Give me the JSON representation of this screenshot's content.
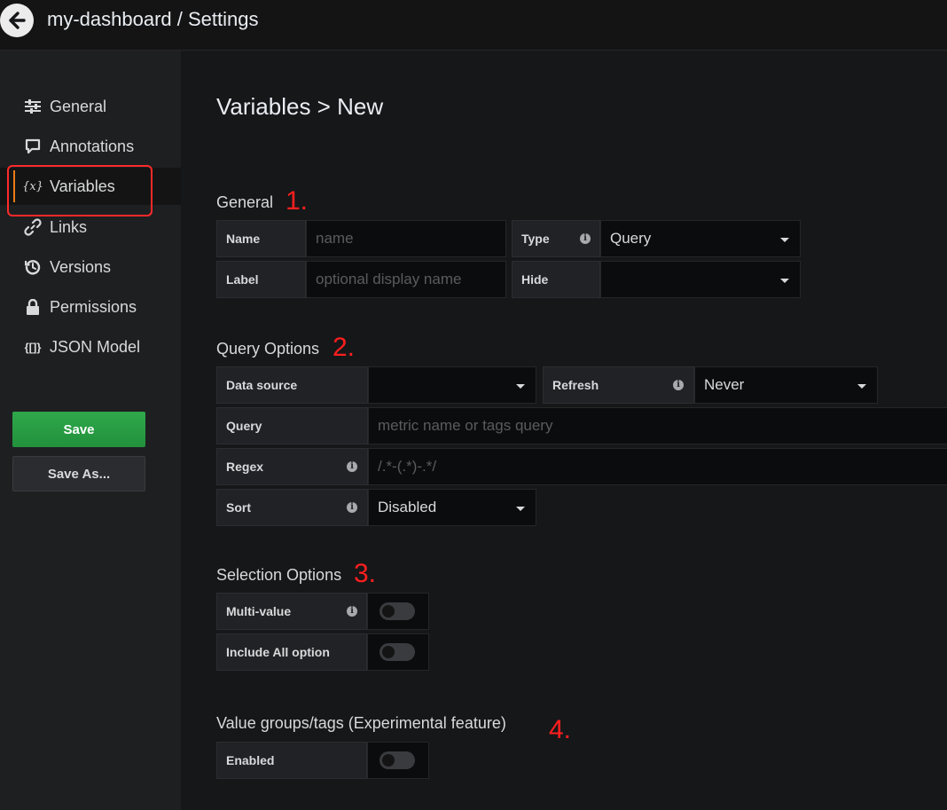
{
  "header": {
    "title": "my-dashboard / Settings"
  },
  "sidebar": {
    "items": [
      {
        "label": "General",
        "icon": "sliders-icon"
      },
      {
        "label": "Annotations",
        "icon": "comment-icon"
      },
      {
        "label": "Variables",
        "icon": "variable-icon",
        "icon_text": "{x}",
        "active": true
      },
      {
        "label": "Links",
        "icon": "link-icon"
      },
      {
        "label": "Versions",
        "icon": "history-icon"
      },
      {
        "label": "Permissions",
        "icon": "lock-icon"
      },
      {
        "label": "JSON Model",
        "icon": "json-icon",
        "icon_text": "{[]}"
      }
    ],
    "save_label": "Save",
    "save_as_label": "Save As..."
  },
  "main": {
    "title": "Variables > New",
    "general": {
      "title": "General",
      "annotation": "1.",
      "name_label": "Name",
      "name_placeholder": "name",
      "type_label": "Type",
      "type_value": "Query",
      "label_label": "Label",
      "label_placeholder": "optional display name",
      "hide_label": "Hide",
      "hide_value": ""
    },
    "query_options": {
      "title": "Query Options",
      "annotation": "2.",
      "datasource_label": "Data source",
      "datasource_value": "",
      "refresh_label": "Refresh",
      "refresh_value": "Never",
      "query_label": "Query",
      "query_placeholder": "metric name or tags query",
      "regex_label": "Regex",
      "regex_placeholder": "/.*-(.*)-.*/",
      "sort_label": "Sort",
      "sort_value": "Disabled"
    },
    "selection_options": {
      "title": "Selection Options",
      "annotation": "3.",
      "multi_value_label": "Multi-value",
      "include_all_label": "Include All option"
    },
    "value_groups": {
      "title": "Value groups/tags (Experimental feature)",
      "annotation": "4.",
      "enabled_label": "Enabled"
    }
  },
  "colors": {
    "accent": "#eb7b18",
    "save_button": "#299c46",
    "annotation_red": "#ff1f1f",
    "background": "#161719"
  }
}
